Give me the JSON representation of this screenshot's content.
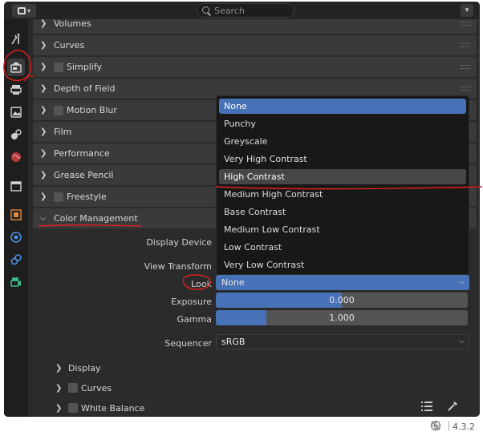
{
  "header": {
    "search_placeholder": "Search",
    "editor_type_icon": "properties-editor-icon",
    "options_icon": "chevron-down-icon"
  },
  "tabs": [
    {
      "icon": "tool-icon",
      "active": false
    },
    {
      "icon": "render-icon",
      "active": true
    },
    {
      "icon": "output-icon",
      "active": false
    },
    {
      "icon": "view-layer-icon",
      "active": false
    },
    {
      "icon": "scene-icon",
      "active": false
    },
    {
      "icon": "world-icon",
      "active": false
    },
    {
      "icon": "collection-icon",
      "active": false
    },
    {
      "icon": "object-icon",
      "active": false
    },
    {
      "icon": "physics-icon",
      "active": false
    },
    {
      "icon": "constraints-icon",
      "active": false
    },
    {
      "icon": "camera-data-icon",
      "active": false
    }
  ],
  "sections": {
    "volumes": "Volumes",
    "curves": "Curves",
    "simplify": "Simplify",
    "depth_of_field": "Depth of Field",
    "motion_blur": "Motion Blur",
    "film": "Film",
    "performance": "Performance",
    "grease_pencil": "Grease Pencil",
    "freestyle": "Freestyle",
    "color_management": "Color Management"
  },
  "color_management": {
    "display_device_label": "Display Device",
    "view_transform_label": "View Transform",
    "look_label": "Look",
    "look_value": "None",
    "exposure_label": "Exposure",
    "exposure_value": "0.000",
    "exposure_fill": 0.5,
    "gamma_label": "Gamma",
    "gamma_value": "1.000",
    "gamma_fill": 0.2,
    "sequencer_label": "Sequencer",
    "sequencer_value": "sRGB"
  },
  "subpanels": {
    "display": "Display",
    "curves": "Curves",
    "white_balance": "White Balance"
  },
  "look_menu": {
    "options": [
      "None",
      "Punchy",
      "Greyscale",
      "Very High Contrast",
      "High Contrast",
      "Medium High Contrast",
      "Base Contrast",
      "Medium Low Contrast",
      "Low Contrast",
      "Very Low Contrast"
    ],
    "selected_index": 0,
    "hover_index": 4
  },
  "status": {
    "version": "4.3.2"
  },
  "colors": {
    "accent": "#4872b7",
    "annotation": "#e02020",
    "panel_bg": "#3a3a3a"
  }
}
